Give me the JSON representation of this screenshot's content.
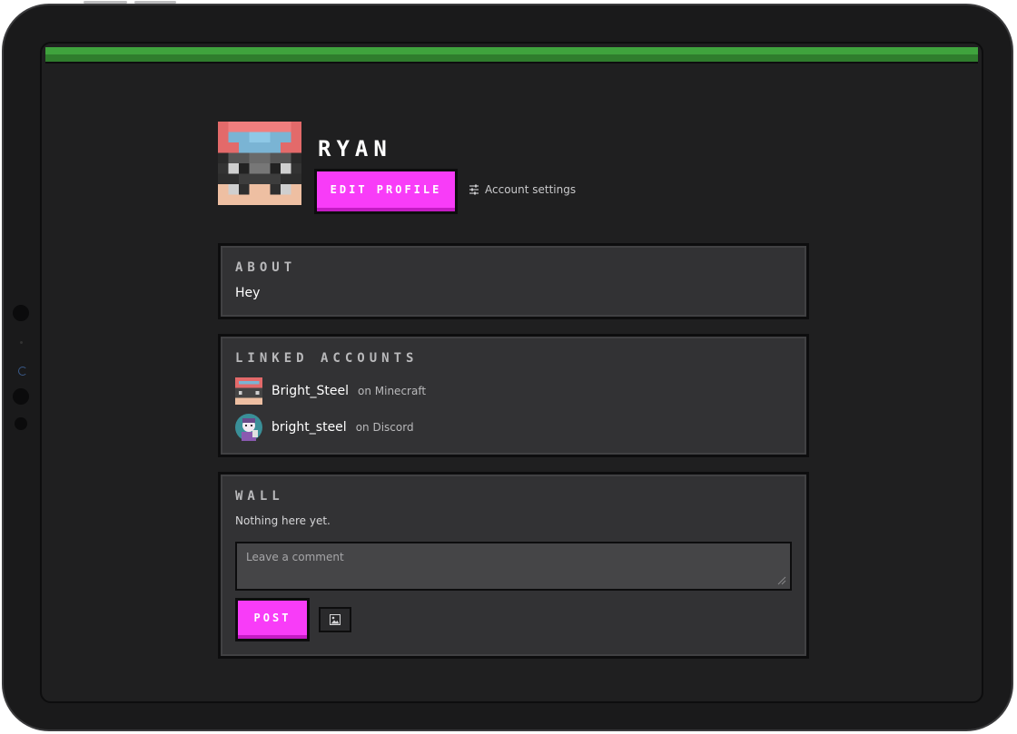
{
  "profile": {
    "username": "RYAN",
    "edit_label": "EDIT PROFILE",
    "settings_label": "Account settings",
    "avatar_icon": "minecraft-skin-avatar"
  },
  "about": {
    "title": "ABOUT",
    "text": "Hey"
  },
  "linked": {
    "title": "LINKED ACCOUNTS",
    "items": [
      {
        "name": "Bright_Steel",
        "platform": "on Minecraft",
        "icon": "minecraft-avatar-icon"
      },
      {
        "name": "bright_steel",
        "platform": "on Discord",
        "icon": "discord-avatar-icon"
      }
    ]
  },
  "wall": {
    "title": "WALL",
    "empty_text": "Nothing here yet.",
    "comment_placeholder": "Leave a comment",
    "post_label": "POST",
    "image_icon": "image-icon"
  },
  "colors": {
    "accent": "#f83cf8",
    "topbar_green": "#3fa33d",
    "card_bg": "#323234",
    "page_bg": "#1f1f20"
  }
}
